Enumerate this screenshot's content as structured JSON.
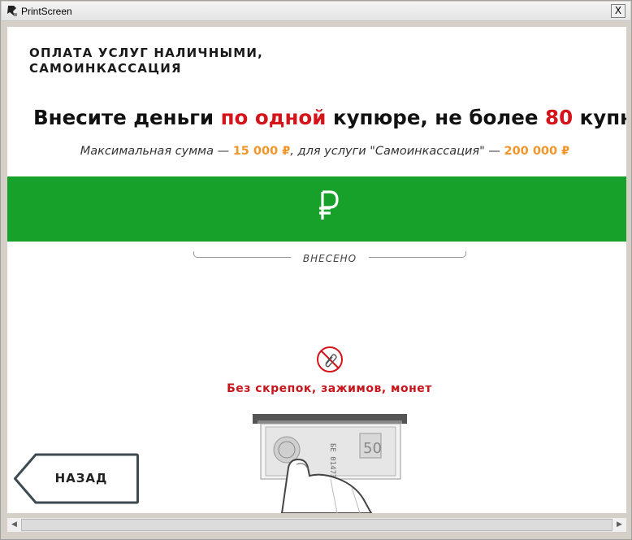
{
  "window": {
    "title": "PrintScreen",
    "close_glyph": "X"
  },
  "service": {
    "title": "ОПЛАТА УСЛУГ НАЛИЧНЫМИ, САМОИНКАССАЦИЯ"
  },
  "headline": {
    "part1": "Внесите деньги ",
    "highlight1": "по одной",
    "part2": " купюре, не более ",
    "highlight2": "80",
    "part3": " купюр"
  },
  "subline": {
    "part1": "Максимальная сумма — ",
    "amount1": "15 000 ₽",
    "part2": ", для услуги \"Самоинкассация\" — ",
    "amount2": "200 000 ₽"
  },
  "deposit": {
    "currency_icon": "ruble-icon",
    "label": "ВНЕСЕНО"
  },
  "warning": {
    "icon": "no-clip-icon",
    "text": "Без скрепок, зажимов, монет"
  },
  "back_button": {
    "label": "НАЗАД"
  },
  "colors": {
    "accent_green": "#17a12b",
    "highlight_red": "#d4141a",
    "amount_orange": "#f0962a",
    "warning_red": "#c8151b"
  }
}
